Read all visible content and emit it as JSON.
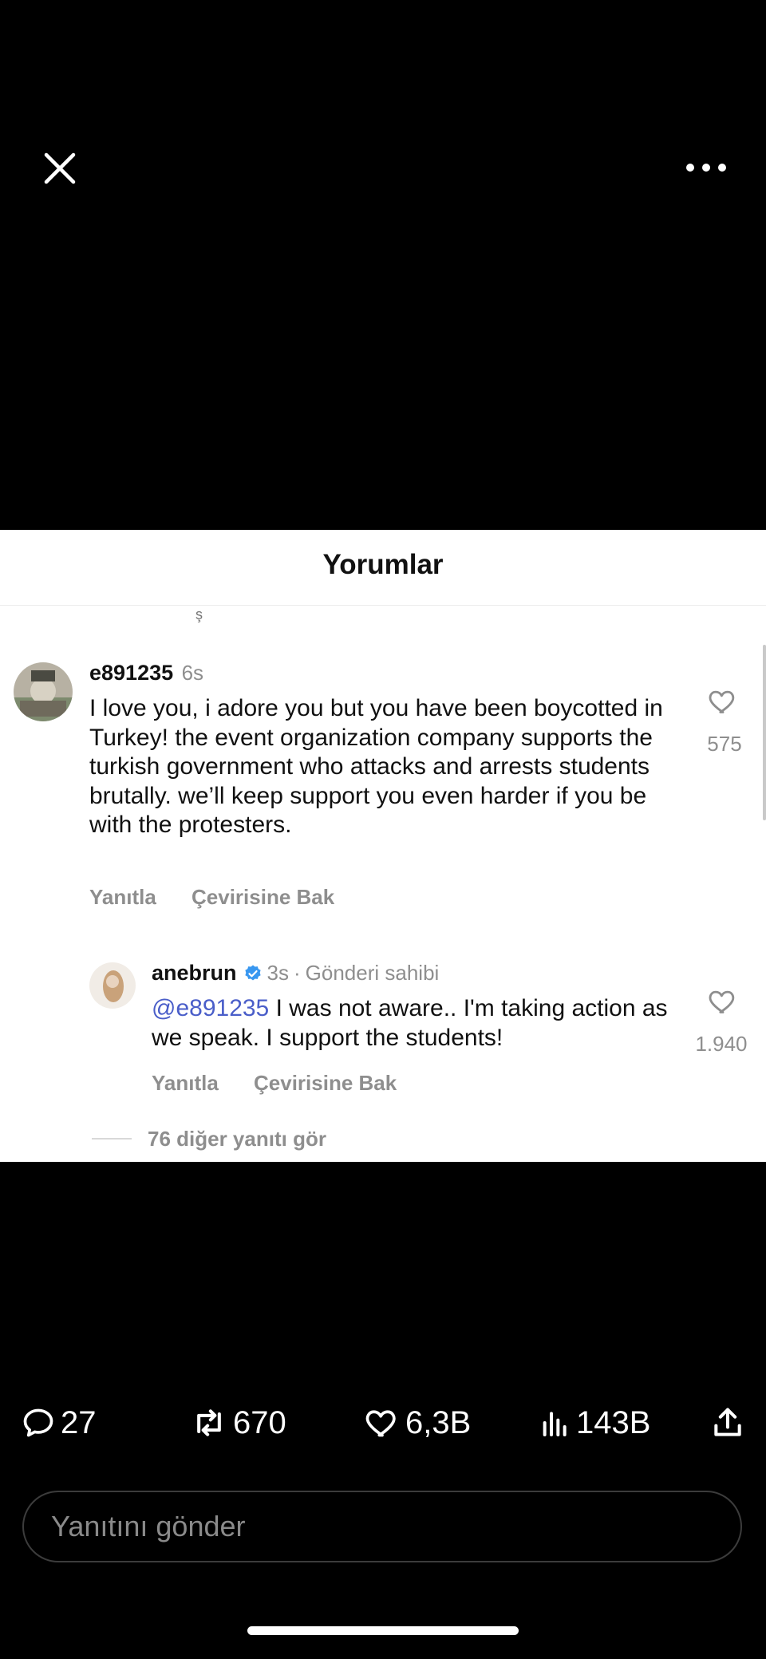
{
  "sheet": {
    "title": "Yorumlar"
  },
  "comments": [
    {
      "username": "e891235",
      "time": "6s",
      "text": "I love you, i adore you but you have been boycotted in Turkey! the event organization company supports the turkish government who attacks and arrests students brutally. we’ll keep support you even harder if you be with the protesters.",
      "reply_label": "Yanıtla",
      "translate_label": "Çevirisine Bak",
      "likes": "575"
    }
  ],
  "reply": {
    "username": "anebrun",
    "time": "3s",
    "separator": "·",
    "author_label": "Gönderi sahibi",
    "mention": "@e891235",
    "text": " I was not aware.. I'm taking action as we speak. I support the students!",
    "reply_label": "Yanıtla",
    "translate_label": "Çevirisine Bak",
    "likes": "1.940"
  },
  "more_replies": "76 diğer yanıtı gör",
  "stats": {
    "comments": "27",
    "reposts": "670",
    "likes": "6,3B",
    "views": "143B"
  },
  "input": {
    "placeholder": "Yanıtını gönder"
  },
  "colors": {
    "verified": "#3897f0",
    "mention": "#4a5ec9",
    "muted": "#8e8e8e"
  },
  "icons": [
    "close-icon",
    "more-icon",
    "heart-icon",
    "verified-icon",
    "comment-icon",
    "repost-icon",
    "views-icon",
    "share-icon"
  ]
}
